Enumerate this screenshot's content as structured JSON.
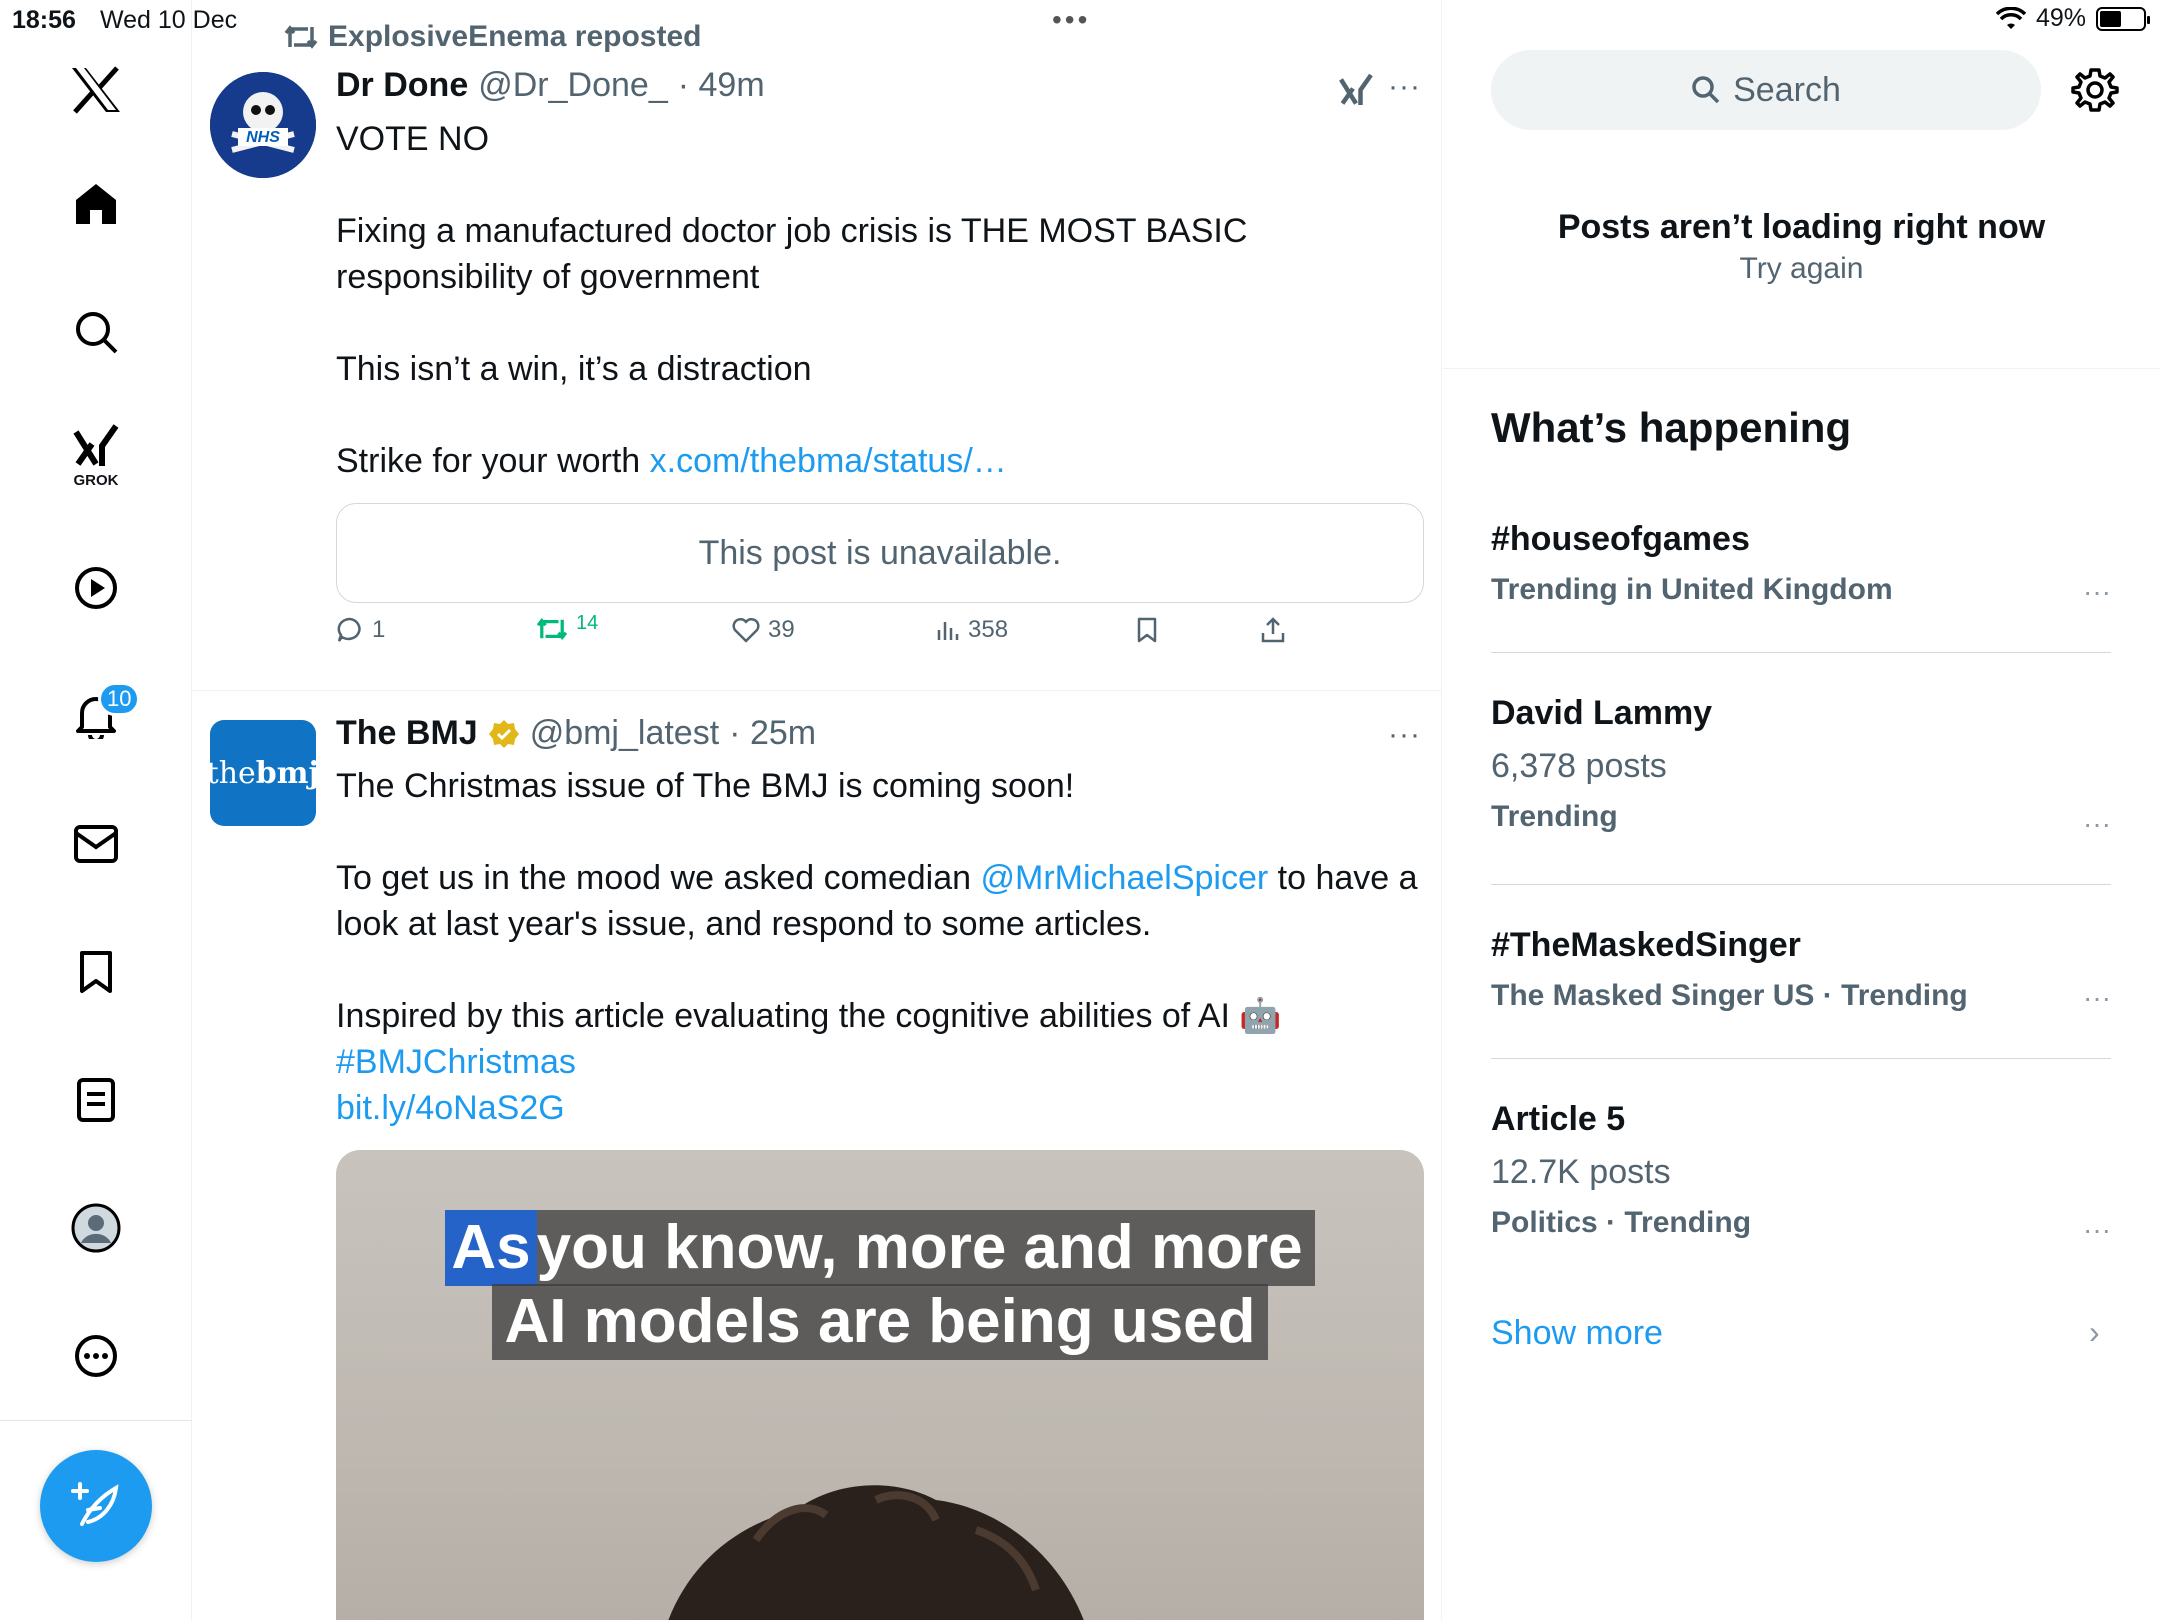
{
  "status_bar": {
    "time": "18:56",
    "date": "Wed 10 Dec",
    "battery": "49%",
    "battery_level": 0.49
  },
  "nav": {
    "items": [
      "x-logo",
      "home",
      "explore",
      "grok",
      "video",
      "notifications",
      "messages",
      "bookmarks",
      "lists",
      "profile",
      "more"
    ],
    "grok_label": "GROK",
    "notifications_badge": "10",
    "accent_color": "#1d9bf0"
  },
  "posts": [
    {
      "repost_by": "ExplosiveEnema reposted",
      "name": "Dr Done",
      "handle": "@Dr_Done_",
      "time": "· 49m",
      "lines": {
        "l1": "VOTE NO",
        "l2": "Fixing a manufactured doctor job crisis is THE MOST BASIC",
        "l3": "responsibility of government",
        "l4": "This isn’t a win, it’s a distraction",
        "l5_pre": "Strike for your worth ",
        "l5_link": "x.com/thebma/status/…"
      },
      "quoted": "This post is unavailable.",
      "stats": {
        "replies": "1",
        "reposts": "14",
        "likes": "39",
        "views": "358"
      }
    },
    {
      "name": "The BMJ",
      "handle": "@bmj_latest",
      "time": "· 25m",
      "avatar_text_a": "the",
      "avatar_text_b": "bmj",
      "lines": {
        "l1": "The Christmas issue of The BMJ is coming soon!",
        "l2_pre": "To get us in the mood we asked comedian ",
        "l2_link": "@MrMichaelSpicer",
        "l2_post": " to have a",
        "l3": "look at last year's issue, and respond to some articles.",
        "l4": "Inspired by this article evaluating the cognitive abilities of AI 🤖",
        "l5_link": "#BMJChristmas",
        "l6_link": "bit.ly/4oNaS2G"
      },
      "media_caption": {
        "hl": "As",
        "rest1": " you know, more and more",
        "line2": "AI models are being used"
      }
    }
  ],
  "sidebar": {
    "search_placeholder": "Search",
    "error_title": "Posts aren’t loading right now",
    "error_retry": "Try again",
    "whats_happening": "What’s happening",
    "trends": [
      {
        "name": "#houseofgames",
        "meta": "Trending in United Kingdom"
      },
      {
        "name": "David Lammy",
        "count": "6,378 posts",
        "meta": "Trending"
      },
      {
        "name": "#TheMaskedSinger",
        "meta": "The Masked Singer US · Trending"
      },
      {
        "name": "Article 5",
        "count": "12.7K posts",
        "meta": "Politics · Trending"
      }
    ],
    "show_more": "Show more"
  }
}
